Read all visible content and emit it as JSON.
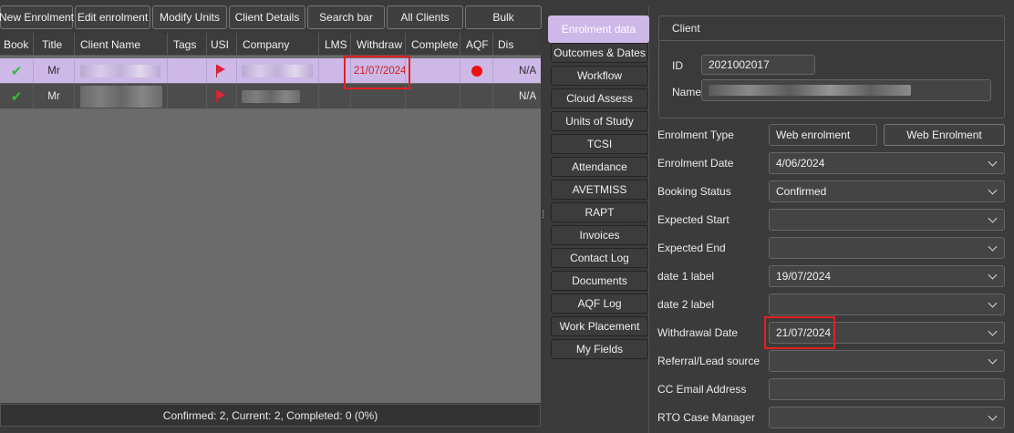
{
  "toolbar": {
    "new_enrolment": "New Enrolment",
    "edit_enrolment": "Edit enrolment",
    "modify_units": "Modify Units",
    "client_details": "Client Details",
    "search_bar": "Search bar",
    "all_clients": "All Clients",
    "bulk": "Bulk"
  },
  "grid": {
    "columns": [
      "Book",
      "Title",
      "Client Name",
      "Tags",
      "USI",
      "Company",
      "LMS",
      "Withdraw",
      "Complete",
      "AQF",
      "Dis"
    ],
    "rows": [
      {
        "book": "✔",
        "title": "Mr",
        "withdraw": "21/07/2024",
        "dis": "N/A",
        "aqf_dot": true
      },
      {
        "book": "✔",
        "title": "Mr",
        "withdraw": "",
        "dis": "N/A",
        "aqf_dot": false
      }
    ]
  },
  "status": {
    "text": "Confirmed: 2, Current: 2, Completed: 0 (0%)"
  },
  "tabs": [
    "Enrolment data",
    "Outcomes & Dates",
    "Workflow",
    "Cloud Assess",
    "Units of Study",
    "TCSI",
    "Attendance",
    "AVETMISS",
    "RAPT",
    "Invoices",
    "Contact Log",
    "Documents",
    "AQF Log",
    "Work Placement",
    "My Fields"
  ],
  "client": {
    "header": "Client",
    "id_label": "ID",
    "id_value": "2021002017",
    "name_label": "Name"
  },
  "form": {
    "enrolment_type_label": "Enrolment Type",
    "enrolment_type_value": "Web enrolment",
    "web_enrolment_button": "Web Enrolment",
    "enrolment_date_label": "Enrolment Date",
    "enrolment_date_value": "4/06/2024",
    "booking_status_label": "Booking Status",
    "booking_status_value": "Confirmed",
    "expected_start_label": "Expected Start",
    "expected_start_value": "",
    "expected_end_label": "Expected End",
    "expected_end_value": "",
    "date1_label": "date 1 label",
    "date1_value": "19/07/2024",
    "date2_label": "date 2 label",
    "date2_value": "",
    "withdrawal_label": "Withdrawal Date",
    "withdrawal_value": "21/07/2024",
    "referral_label": "Referral/Lead source",
    "referral_value": "",
    "cc_email_label": "CC Email Address",
    "cc_email_value": "",
    "rto_case_label": "RTO Case Manager",
    "rto_case_value": ""
  },
  "colors": {
    "accent": "#cdb8e8",
    "highlight": "#e32020",
    "check": "#2fbf3a"
  }
}
